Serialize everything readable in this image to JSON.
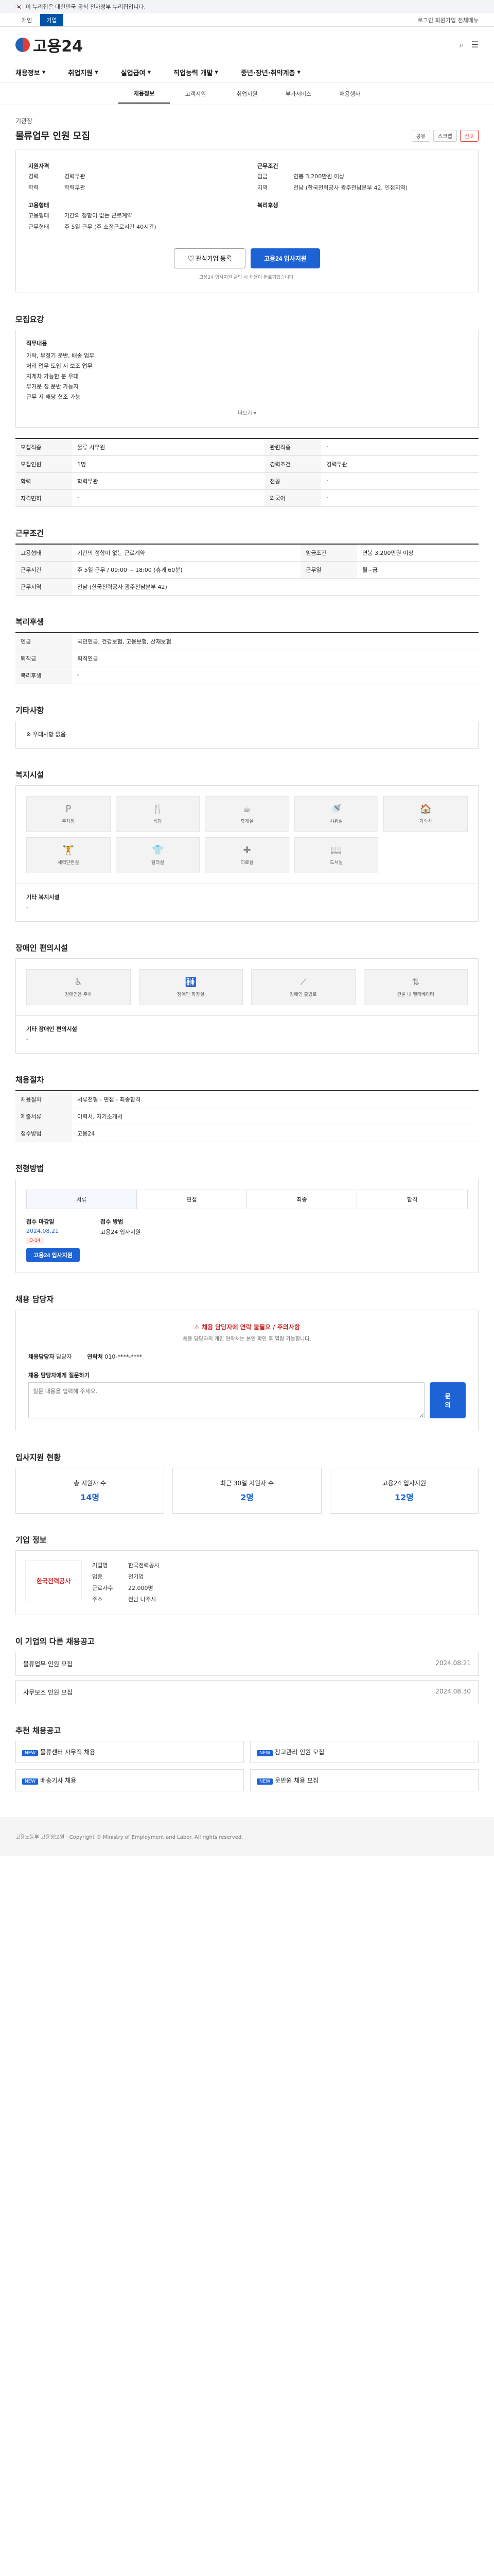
{
  "gov_bar": {
    "text": "이 누리집은 대한민국 공식 전자정부 누리집입니다."
  },
  "gov_tabs": {
    "items": [
      "개인",
      "기업"
    ],
    "active": "기업",
    "right": "로그인  회원가입  전체메뉴"
  },
  "header": {
    "logo": "고용24"
  },
  "gnb": [
    "채용정보",
    "취업지원",
    "실업급여",
    "직업능력 개발",
    "중년·장년·취약계층"
  ],
  "sub_tabs": [
    "채용정보",
    "고객지원",
    "취업지원",
    "부가서비스",
    "채용행사"
  ],
  "job": {
    "company": "기관장",
    "title": "물류업무 인원 모집",
    "share": "공유",
    "scrap": "스크랩",
    "report": "신고",
    "qualification": {
      "title": "지원자격",
      "rows": [
        [
          "경력",
          "경력무관"
        ],
        [
          "학력",
          "학력무관"
        ]
      ]
    },
    "condition": {
      "title": "근무조건",
      "rows": [
        [
          "임금",
          "연봉 3,200만원 이상"
        ],
        [
          "지역",
          "전남 (한국전력공사 광주전남본부 42, 인접지역)"
        ]
      ]
    },
    "type": {
      "title": "고용형태",
      "rows": [
        [
          "고용형태",
          "기간의 정함이 없는 근로계약"
        ],
        [
          "근무형태",
          "주 5일 근무 (주 소정근로시간 40시간)"
        ]
      ]
    },
    "welfare": {
      "title": "복리후생"
    },
    "btn_interest": "관심기업 등록",
    "btn_apply": "고용24 입사지원",
    "apply_note": "고용24 입사지원 클릭 시 채용이 완료되었습니다."
  },
  "duty": {
    "title": "모집요강",
    "h": "직무내용",
    "lines": [
      "가락, 부정기 운반, 배송 업무",
      "처리 업무 도입 시 보조 업무",
      "지게차 가능한 분 우대",
      "무거운 짐 운반 가능자",
      "근무 지 해당 협조 가능"
    ],
    "more": "더보기"
  },
  "info_table": {
    "rows": [
      [
        "모집직종",
        "물류 사무원",
        "관련직종",
        "-"
      ],
      [
        "모집인원",
        "1명",
        "경력조건",
        "경력무관"
      ],
      [
        "학력",
        "학력무관",
        "전공",
        "-"
      ],
      [
        "자격면허",
        "-",
        "외국어",
        "-"
      ]
    ]
  },
  "work_cond": {
    "title": "근무조건",
    "rows": [
      [
        "고용형태",
        "기간의 정함이 없는 근로계약",
        "임금조건",
        "연봉 3,200만원 이상"
      ],
      [
        "근무시간",
        "주 5일 근무 / 09:00 ~ 18:00 (휴게 60분)",
        "근무일",
        "월~금"
      ],
      [
        "근무지역",
        "전남 (한국전력공사 광주전남본부 42)",
        "",
        ""
      ]
    ]
  },
  "welfare_sec": {
    "title": "복리후생",
    "rows": [
      [
        "연금",
        "국민연금, 건강보험, 고용보험, 산재보험"
      ],
      [
        "퇴직금",
        "퇴직연금"
      ],
      [
        "복리후생",
        "-"
      ]
    ]
  },
  "extra": {
    "title": "기타사항",
    "line": "※ 우대사항 없음"
  },
  "facilities": {
    "title": "복지시설",
    "items": [
      "주차장",
      "식당",
      "휴게실",
      "샤워실",
      "기숙사",
      "체력단련실",
      "탈의실",
      "의료실",
      "도서실"
    ],
    "note_label": "기타 복지시설",
    "note_value": "-"
  },
  "disability": {
    "title": "장애인 편의시설",
    "items": [
      "장애인용 주차",
      "장애인 화장실",
      "장애인 출입로",
      "건물 내 엘리베이터"
    ],
    "note_label": "기타 장애인 편의시설",
    "note_value": "-"
  },
  "recruit_info": {
    "title": "채용절차",
    "rows": [
      [
        "채용절차",
        "서류전형 - 면접 - 최종합격"
      ],
      [
        "제출서류",
        "이력서, 자기소개서"
      ],
      [
        "접수방법",
        "고용24"
      ]
    ]
  },
  "process": {
    "title": "전형방법",
    "steps": [
      "서류",
      "면접",
      "최종",
      "합격"
    ],
    "deadline_label": "접수 마감일",
    "deadline": "2024.08.21",
    "d_badge": "D-14",
    "method_label": "접수 방법",
    "method": "고용24 입사지원"
  },
  "inquiry": {
    "title": "채용 담당자",
    "warn": "채용 담당자에 연락 불필요 / 주의사항",
    "warn_text": "채용 담당자의 개인 연락처는 본인 확인 후 열람 가능합니다.",
    "name_label": "채용담당자",
    "name": "담당자",
    "phone_label": "연락처",
    "phone": "010-****-****",
    "qa_label": "채용 담당자에게 질문하기",
    "qa_placeholder": "질문 내용을 입력해 주세요.",
    "qa_btn": "문의"
  },
  "stats": {
    "title": "입사지원 현황",
    "items": [
      [
        "총 지원자 수",
        "14명"
      ],
      [
        "최근 30일 지원자 수",
        "2명"
      ],
      [
        "고용24 입사지원",
        "12명"
      ]
    ]
  },
  "company_info": {
    "title": "기업 정보",
    "logo": "한국전력공사",
    "rows": [
      [
        "기업명",
        "한국전력공사"
      ],
      [
        "업종",
        "전기업"
      ],
      [
        "근로자수",
        "22,000명"
      ],
      [
        "주소",
        "전남 나주시"
      ]
    ]
  },
  "other_jobs": {
    "title": "이 기업의 다른 채용공고",
    "items": [
      [
        "물류업무 인원 모집",
        "2024.08.21"
      ],
      [
        "사무보조 인원 모집",
        "2024.08.30"
      ]
    ]
  },
  "recommend": {
    "title": "추천 채용공고",
    "items": [
      "물류센터 사무직 채용",
      "창고관리 인원 모집",
      "배송기사 채용",
      "운반원 채용 모집"
    ]
  },
  "footer": {
    "text": "고용노동부 고용정보원 · Copyright © Ministry of Employment and Labor. All rights reserved."
  }
}
